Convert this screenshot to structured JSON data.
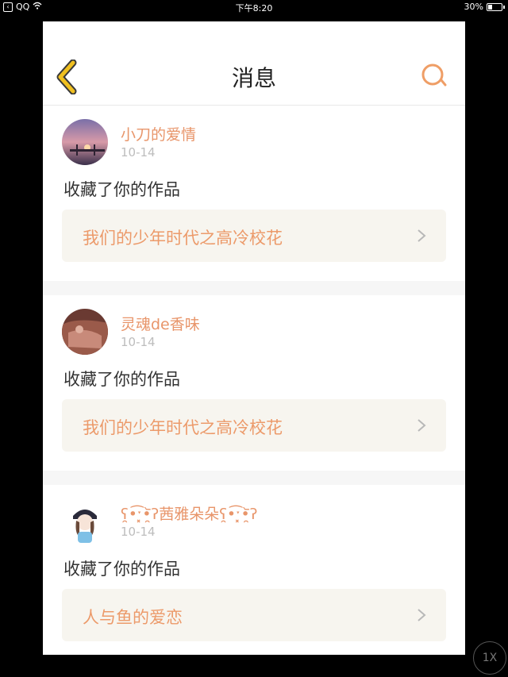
{
  "statusbar": {
    "back_app": "QQ",
    "time": "下午8:20",
    "battery": "30%"
  },
  "nav": {
    "title": "消息"
  },
  "messages": [
    {
      "user": "小刀的爱情",
      "date": "10-14",
      "action": "收藏了你的作品",
      "work": "我们的少年时代之高冷校花"
    },
    {
      "user": "灵魂de香味",
      "date": "10-14",
      "action": "收藏了你的作品",
      "work": "我们的少年时代之高冷校花"
    },
    {
      "user": "ʕ̯•͡ˑ͓•̯᷅ʔ茜雅朵朵ʕ̯•͡ˑ͓•̯᷅ʔ",
      "date": "10-14",
      "action": "收藏了你的作品",
      "work": "人与鱼的爱恋"
    }
  ],
  "zoom": "1X",
  "colors": {
    "accent": "#e8956a",
    "back_icon": "#f0c020"
  }
}
